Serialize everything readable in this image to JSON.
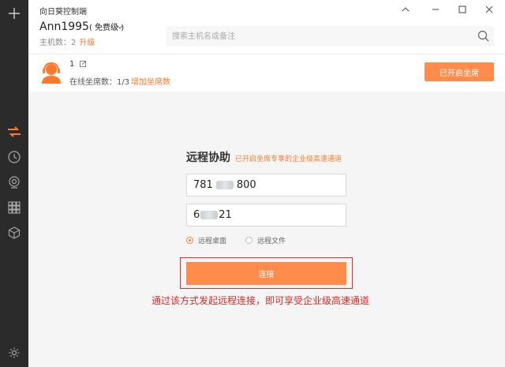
{
  "window": {
    "app_title": "向日葵控制端"
  },
  "sidebar": {
    "icons": [
      "plus-icon",
      "swap-arrows-icon",
      "clock-icon",
      "location-pin-icon",
      "grid-icon",
      "cube-icon",
      "gear-icon"
    ]
  },
  "header": {
    "username": "Ann1995",
    "plan": "( 免费级 )",
    "hosts_label": "主机数：2",
    "upgrade": "升级",
    "search_placeholder": "搜索主机名或备注"
  },
  "seat": {
    "number": "1",
    "online_label": "在线坐席数：1/3",
    "add_link": "增加坐席数",
    "button": "已开启坐席"
  },
  "remote": {
    "title": "远程协助",
    "subtitle": "已开启坐席专享的企业级高速通道",
    "id_prefix": "781",
    "id_suffix": "800",
    "code_prefix": "6",
    "code_suffix": "21",
    "options": [
      {
        "label": "远程桌面",
        "selected": true
      },
      {
        "label": "远程文件",
        "selected": false
      }
    ],
    "connect": "连接"
  },
  "annotation": "通过该方式发起远程连接，即可享受企业级高速通道",
  "colors": {
    "accent": "#ff8c4a",
    "sidebar": "#2b2b2b",
    "annotation": "#e0282a"
  }
}
